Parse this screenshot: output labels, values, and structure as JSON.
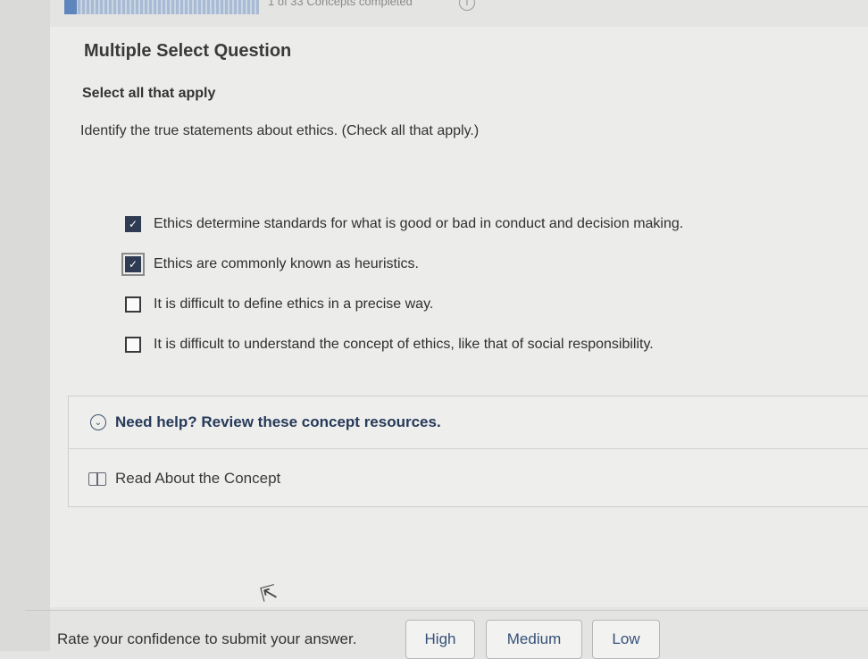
{
  "progress": {
    "text": "1 of 33 Concepts completed",
    "info_symbol": "i",
    "completed": 1,
    "total": 33
  },
  "question": {
    "type": "Multiple Select Question",
    "instruction": "Select all that apply",
    "prompt": "Identify the true statements about ethics. (Check all that apply.)",
    "options": [
      {
        "label": "Ethics determine standards for what is good or bad in conduct and decision making.",
        "checked": true
      },
      {
        "label": "Ethics are commonly known as heuristics.",
        "checked": true
      },
      {
        "label": "It is difficult to define ethics in a precise way.",
        "checked": false
      },
      {
        "label": "It is difficult to understand the concept of ethics, like that of social responsibility.",
        "checked": false
      }
    ]
  },
  "help": {
    "title": "Need help? Review these concept resources.",
    "link": "Read About the Concept"
  },
  "confidence": {
    "label": "Rate your confidence to submit your answer.",
    "high": "High",
    "medium": "Medium",
    "low": "Low"
  },
  "icons": {
    "check": "✓",
    "chevron": "⌄",
    "cursor": "⇱"
  }
}
